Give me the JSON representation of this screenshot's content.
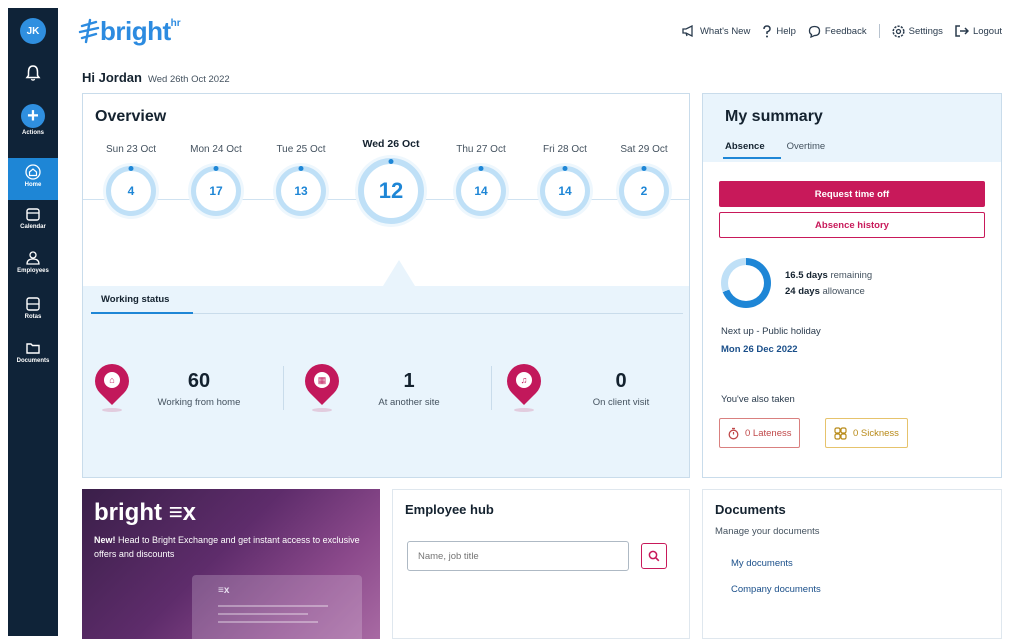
{
  "sidebar": {
    "avatar_initials": "JK",
    "items": [
      {
        "label": "Actions",
        "icon": "plus-icon"
      },
      {
        "label": "Home",
        "icon": "home-icon",
        "active": true
      },
      {
        "label": "Calendar",
        "icon": "calendar-icon"
      },
      {
        "label": "Employees",
        "icon": "employees-icon"
      },
      {
        "label": "Rotas",
        "icon": "rotas-icon"
      },
      {
        "label": "Documents",
        "icon": "documents-icon"
      }
    ]
  },
  "header": {
    "logo_text": "bright",
    "logo_suffix": "hr",
    "links": [
      {
        "label": "What's New",
        "icon": "megaphone-icon"
      },
      {
        "label": "Help",
        "icon": "help-icon"
      },
      {
        "label": "Feedback",
        "icon": "feedback-icon"
      },
      {
        "label": "Settings",
        "icon": "gear-icon"
      },
      {
        "label": "Logout",
        "icon": "logout-icon"
      }
    ]
  },
  "greeting": {
    "text": "Hi Jordan",
    "date": "Wed 26th Oct 2022"
  },
  "overview": {
    "title": "Overview",
    "days": [
      {
        "label": "Sun 23 Oct",
        "count": "4"
      },
      {
        "label": "Mon 24 Oct",
        "count": "17"
      },
      {
        "label": "Tue 25 Oct",
        "count": "13"
      },
      {
        "label": "Wed 26 Oct",
        "count": "12",
        "selected": true
      },
      {
        "label": "Thu 27 Oct",
        "count": "14"
      },
      {
        "label": "Fri 28 Oct",
        "count": "14"
      },
      {
        "label": "Sat 29 Oct",
        "count": "2"
      }
    ],
    "tab_label": "Working status",
    "stats": [
      {
        "value": "60",
        "caption": "Working from home"
      },
      {
        "value": "1",
        "caption": "At another site"
      },
      {
        "value": "0",
        "caption": "On client visit"
      }
    ]
  },
  "summary": {
    "title": "My summary",
    "tabs": [
      "Absence",
      "Overtime"
    ],
    "request_button": "Request time off",
    "history_button": "Absence history",
    "remaining_value": "16.5 days",
    "remaining_label": "remaining",
    "allowance_value": "24 days",
    "allowance_label": "allowance",
    "remaining_fraction": 0.69,
    "next_up_label": "Next up - Public holiday",
    "next_up_date": "Mon 26 Dec 2022",
    "taken_label": "You've also taken",
    "lateness": "0 Lateness",
    "sickness": "0 Sickness"
  },
  "promo": {
    "logo": "bright ≡x",
    "new_label": "New!",
    "text": " Head to Bright Exchange and get instant access to exclusive offers and discounts"
  },
  "employee_hub": {
    "title": "Employee hub",
    "search_placeholder": "Name, job title"
  },
  "documents": {
    "title": "Documents",
    "subtitle": "Manage your documents",
    "links": [
      "My documents",
      "Company documents"
    ]
  },
  "colors": {
    "sidebar": "#0f2338",
    "accent_blue": "#1e86d6",
    "brand_pink": "#c8195a"
  }
}
